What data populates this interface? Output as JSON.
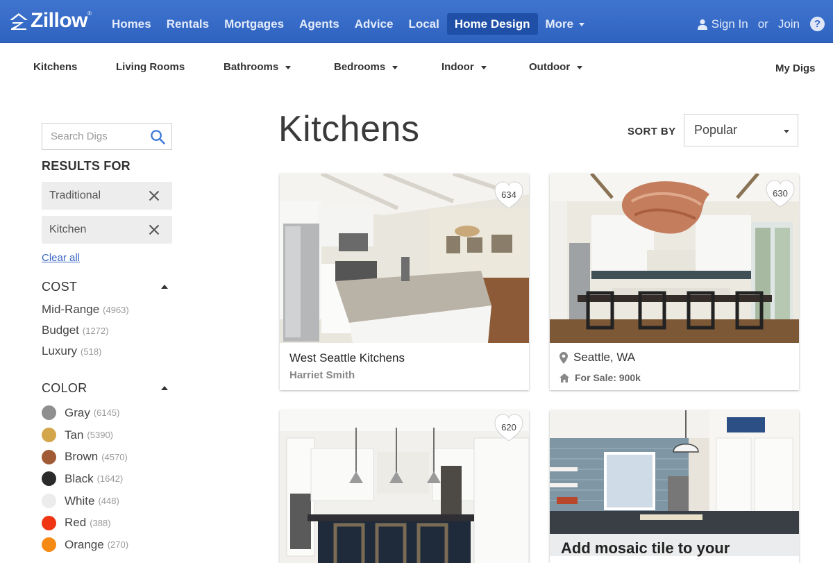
{
  "brand": {
    "name": "Zillow",
    "registered": "®"
  },
  "topnav": {
    "links": [
      "Homes",
      "Rentals",
      "Mortgages",
      "Agents",
      "Advice",
      "Local",
      "Home Design",
      "More"
    ],
    "active": "Home Design",
    "sign_in": "Sign In",
    "or": "or",
    "join": "Join",
    "help": "?"
  },
  "subnav": {
    "items": [
      "Kitchens",
      "Living Rooms",
      "Bathrooms",
      "Bedrooms",
      "Indoor",
      "Outdoor"
    ],
    "my_digs": "My Digs"
  },
  "sidebar": {
    "search_placeholder": "Search Digs",
    "results_for": "RESULTS FOR",
    "filters": [
      "Traditional",
      "Kitchen"
    ],
    "clear_all": "Clear all",
    "cost": {
      "heading": "COST",
      "items": [
        {
          "label": "Mid-Range",
          "count": "(4963)"
        },
        {
          "label": "Budget",
          "count": "(1272)"
        },
        {
          "label": "Luxury",
          "count": "(518)"
        }
      ]
    },
    "color": {
      "heading": "COLOR",
      "items": [
        {
          "label": "Gray",
          "count": "(6145)",
          "swatch": "#8f8f8f"
        },
        {
          "label": "Tan",
          "count": "(5390)",
          "swatch": "#d4a64c"
        },
        {
          "label": "Brown",
          "count": "(4570)",
          "swatch": "#a05a35"
        },
        {
          "label": "Black",
          "count": "(1642)",
          "swatch": "#2b2b2b"
        },
        {
          "label": "White",
          "count": "(448)",
          "swatch": "#ececec"
        },
        {
          "label": "Red",
          "count": "(388)",
          "swatch": "#f03513"
        },
        {
          "label": "Orange",
          "count": "(270)",
          "swatch": "#f58a15"
        }
      ]
    }
  },
  "main": {
    "title": "Kitchens",
    "sort_label": "SORT BY",
    "sort_value": "Popular",
    "cards": [
      {
        "likes": "634",
        "title": "West Seattle Kitchens",
        "author": "Harriet Smith"
      },
      {
        "likes": "630",
        "location": "Seattle, WA",
        "sale": "For Sale: 900k"
      },
      {
        "likes": "620"
      },
      {
        "caption": "Add mosaic tile to your"
      }
    ]
  },
  "colors": {
    "nav_blue": "#3569c6",
    "active_tab": "#1f4fa6",
    "link": "#3b67c4"
  }
}
